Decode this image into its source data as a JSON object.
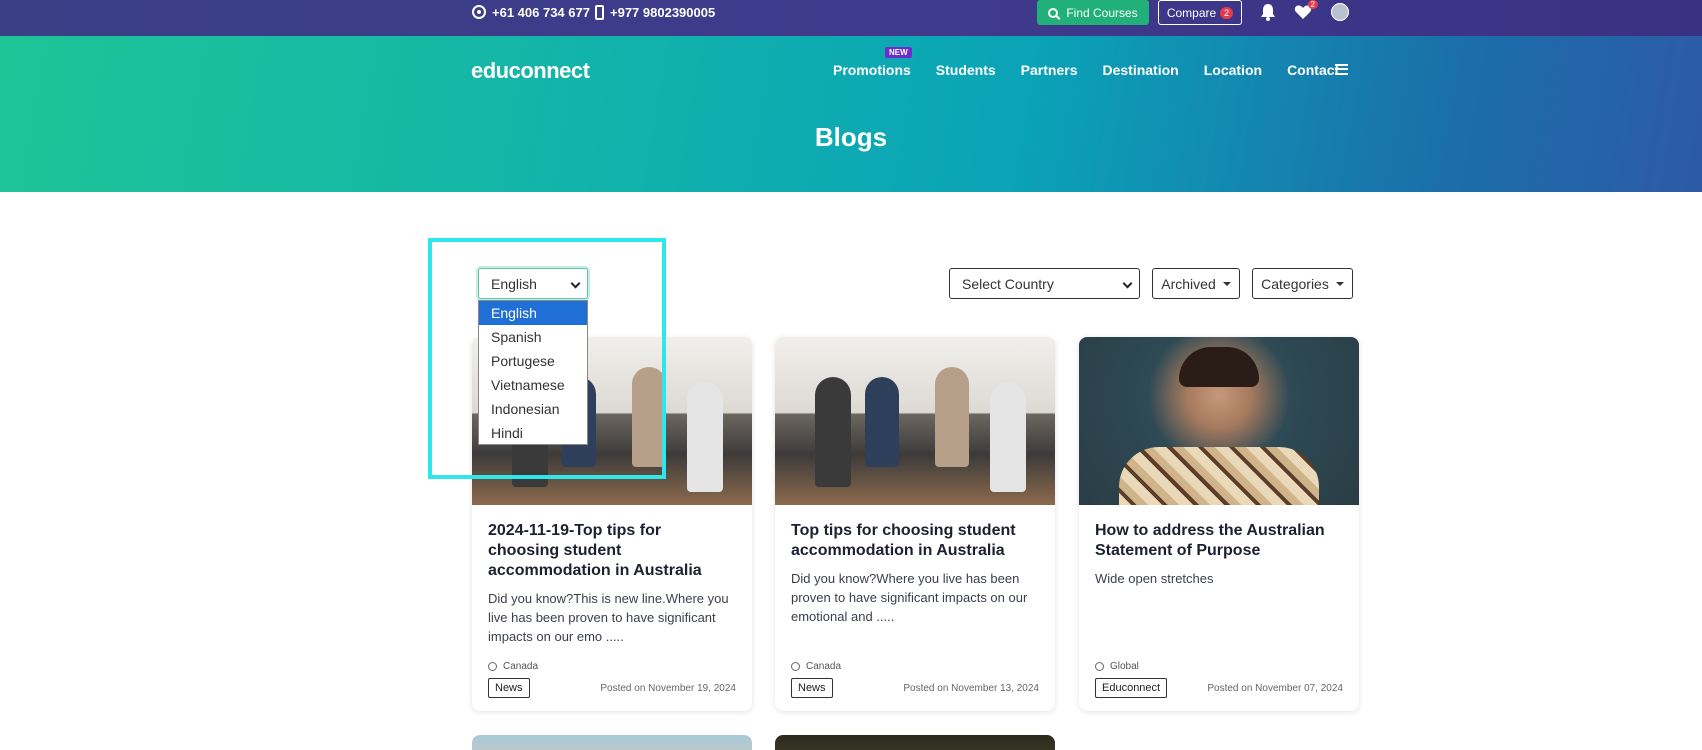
{
  "topbar": {
    "whatsapp": "+61 406 734 677",
    "phone": "+977 9802390005",
    "find_courses": "Find Courses",
    "compare_label": "Compare",
    "compare_count": "2",
    "wishlist_count": "2"
  },
  "header": {
    "logo": "educonnect",
    "nav": {
      "promotions": "Promotions",
      "promotions_badge": "NEW",
      "students": "Students",
      "partners": "Partners",
      "destination": "Destination",
      "location": "Location",
      "contact": "Contact"
    },
    "title": "Blogs"
  },
  "filters": {
    "language_selected": "English",
    "language_options": [
      "English",
      "Spanish",
      "Portugese",
      "Vietnamese",
      "Indonesian",
      "Hindi"
    ],
    "country_placeholder": "Select Country",
    "archived": "Archived",
    "categories": "Categories"
  },
  "cards": [
    {
      "title": "2024-11-19-Top tips for choosing student accommodation in Australia",
      "excerpt": "Did you know?This is new line.Where you live has been proven to have significant impacts on our emo .....",
      "location": "Canada",
      "tag": "News",
      "date": "Posted on November 19, 2024"
    },
    {
      "title": "Top tips for choosing student accommodation in Australia",
      "excerpt": "Did you know?Where you live has been proven to have significant impacts on our emotional and .....",
      "location": "Canada",
      "tag": "News",
      "date": "Posted on November 13, 2024"
    },
    {
      "title": "How to address the Australian Statement of Purpose",
      "excerpt": "Wide open stretches",
      "location": "Global",
      "tag": "Educonnect",
      "date": "Posted on November 07, 2024"
    }
  ],
  "colors": {
    "topbar": "#3b3d88",
    "find_courses": "#22b07a",
    "badge_red": "#e43b4f",
    "promo_badge": "#6b2ecc",
    "option_selected": "#1f6fd6",
    "highlight_box": "#2fe7ea"
  }
}
